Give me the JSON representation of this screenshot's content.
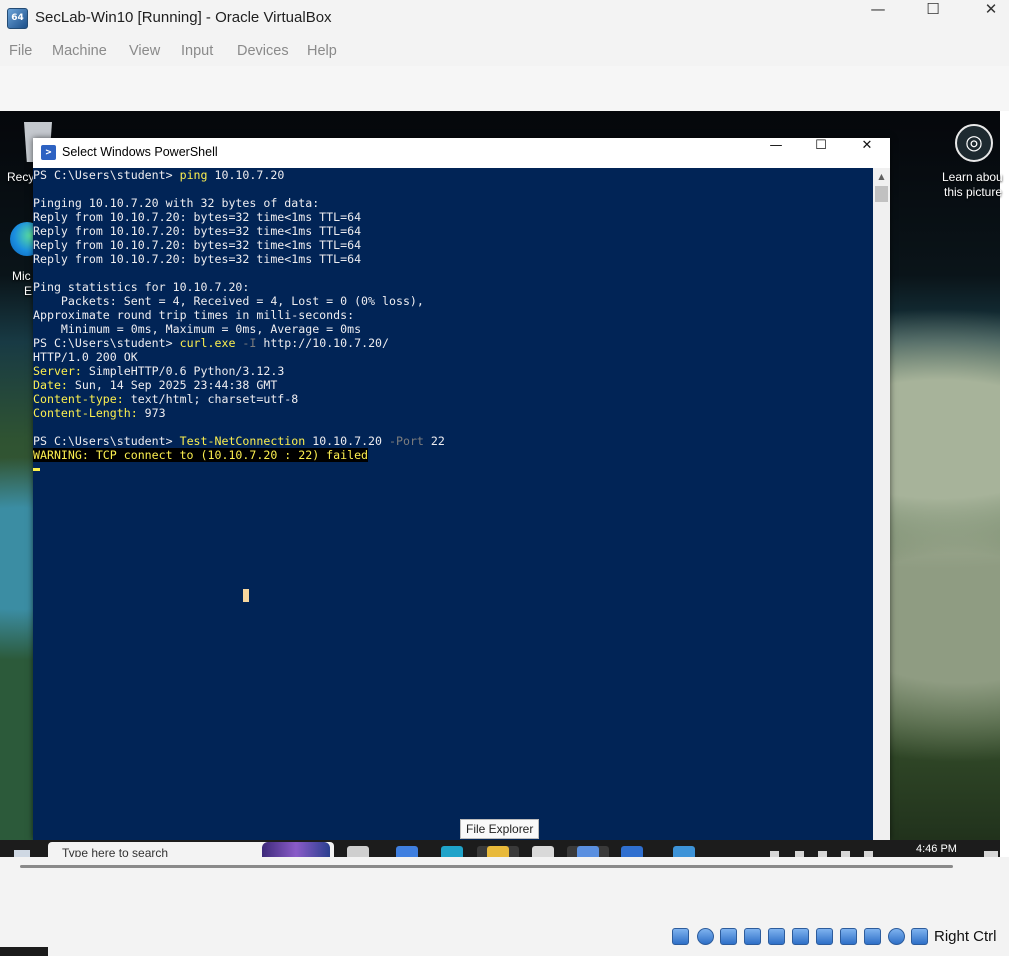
{
  "host_window": {
    "title": "SecLab-Win10 [Running] - Oracle VirtualBox",
    "app_icon_text": "64",
    "controls": {
      "minimize": "—",
      "maximize": "☐",
      "close": "✕"
    }
  },
  "menu": [
    "File",
    "Machine",
    "View",
    "Input",
    "Devices",
    "Help"
  ],
  "desktop_icons": {
    "recycle_bin": "Recy",
    "edge_line1": "Mic",
    "edge_line2": "E",
    "learn_line1": "Learn abou",
    "learn_line2": "this picture"
  },
  "powershell": {
    "title": "Select Windows PowerShell",
    "icon_text": ">",
    "lines": [
      [
        {
          "t": "PS C:\\Users\\student> "
        },
        {
          "t": "ping",
          "c": "cmd"
        },
        {
          "t": " 10.10.7.20"
        }
      ],
      [
        {
          "t": ""
        }
      ],
      [
        {
          "t": "Pinging 10.10.7.20 with 32 bytes of data:"
        }
      ],
      [
        {
          "t": "Reply from 10.10.7.20: bytes=32 time<1ms TTL=64"
        }
      ],
      [
        {
          "t": "Reply from 10.10.7.20: bytes=32 time<1ms TTL=64"
        }
      ],
      [
        {
          "t": "Reply from 10.10.7.20: bytes=32 time<1ms TTL=64"
        }
      ],
      [
        {
          "t": "Reply from 10.10.7.20: bytes=32 time<1ms TTL=64"
        }
      ],
      [
        {
          "t": ""
        }
      ],
      [
        {
          "t": "Ping statistics for 10.10.7.20:"
        }
      ],
      [
        {
          "t": "    Packets: Sent = 4, Received = 4, Lost = 0 (0% loss),"
        }
      ],
      [
        {
          "t": "Approximate round trip times in milli-seconds:"
        }
      ],
      [
        {
          "t": "    Minimum = 0ms, Maximum = 0ms, Average = 0ms"
        }
      ],
      [
        {
          "t": "PS C:\\Users\\student> "
        },
        {
          "t": "curl.exe",
          "c": "cmd"
        },
        {
          "t": " -I",
          "c": "param"
        },
        {
          "t": " http://10.10.7.20/"
        }
      ],
      [
        {
          "t": "HTTP/1.0 200 OK"
        }
      ],
      [
        {
          "t": "Server:",
          "c": "hdr"
        },
        {
          "t": " SimpleHTTP/0.6 Python/3.12.3"
        }
      ],
      [
        {
          "t": "Date:",
          "c": "hdr"
        },
        {
          "t": " Sun, 14 Sep 2025 23:44:38 GMT"
        }
      ],
      [
        {
          "t": "Content-type:",
          "c": "hdr"
        },
        {
          "t": " text/html; charset=utf-8"
        }
      ],
      [
        {
          "t": "Content-Length:",
          "c": "hdr"
        },
        {
          "t": " 973"
        }
      ],
      [
        {
          "t": ""
        }
      ],
      [
        {
          "t": "PS C:\\Users\\student> "
        },
        {
          "t": "Test-NetConnection",
          "c": "cmd"
        },
        {
          "t": " 10.10.7.20 "
        },
        {
          "t": "-Port",
          "c": "param"
        },
        {
          "t": " 22"
        }
      ],
      [
        {
          "t": "WARNING: TCP connect to (10.10.7.20 : 22) failed",
          "c": "warn"
        }
      ]
    ]
  },
  "tooltip": "File Explorer",
  "taskbar": {
    "search_placeholder": "Type here to search",
    "clock": "4:46 PM"
  },
  "status_bar": {
    "host_key": "Right Ctrl"
  },
  "colors": {
    "ps_background": "#012456",
    "ps_text": "#eeedf0",
    "ps_command": "#fcef4f",
    "ps_parameter": "#7d7d7d"
  }
}
